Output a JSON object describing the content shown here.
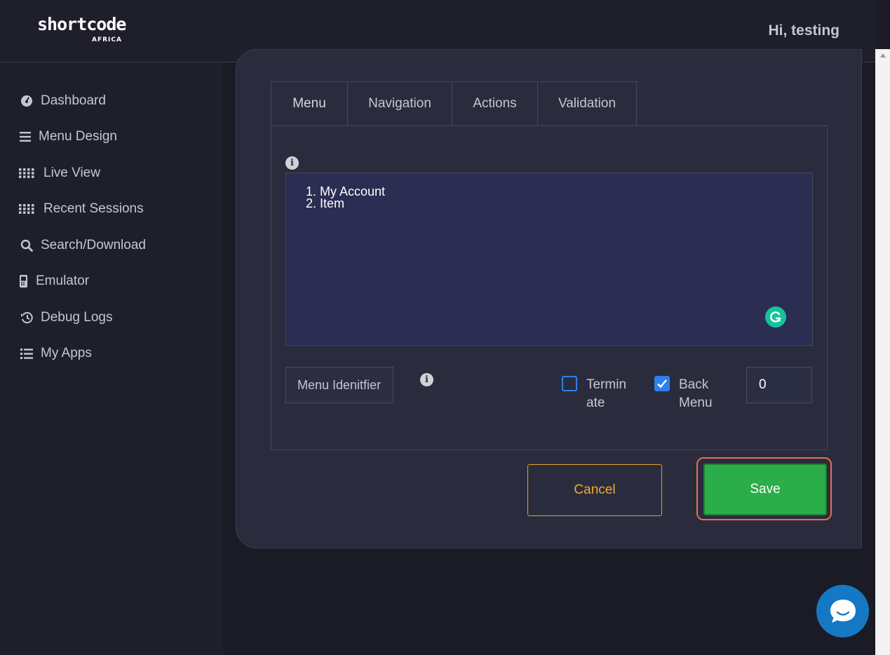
{
  "header": {
    "logo_text": "shortcode",
    "logo_subtext": "AFRICA",
    "greeting": "Hi, testing"
  },
  "sidebar": {
    "items": [
      {
        "label": "Dashboard",
        "icon": "gauge-icon"
      },
      {
        "label": "Menu Design",
        "icon": "bars-icon"
      },
      {
        "label": "Live View",
        "icon": "grid-dots-icon"
      },
      {
        "label": "Recent Sessions",
        "icon": "grid-dots-icon"
      },
      {
        "label": "Search/Download",
        "icon": "search-icon"
      },
      {
        "label": "Emulator",
        "icon": "phone-icon"
      },
      {
        "label": "Debug Logs",
        "icon": "history-icon"
      },
      {
        "label": "My Apps",
        "icon": "list-icon"
      }
    ]
  },
  "tabs": [
    {
      "label": "Menu",
      "active": true
    },
    {
      "label": "Navigation",
      "active": false
    },
    {
      "label": "Actions",
      "active": false
    },
    {
      "label": "Validation",
      "active": false
    }
  ],
  "menu_panel": {
    "menu_text": "1. My Account\n2. Item",
    "identifier_placeholder": "Menu Idenitfier",
    "terminate": {
      "label_line1": "Termin",
      "label_line2": "ate",
      "checked": false
    },
    "back_menu": {
      "label_line1": "Back",
      "label_line2": "Menu",
      "checked": true
    },
    "number_value": "0"
  },
  "buttons": {
    "cancel_label": "Cancel",
    "save_label": "Save"
  },
  "colors": {
    "accent_green": "#2bad4a",
    "cancel_orange": "#f0a830",
    "highlight_outline": "#e8704a",
    "checkbox_blue": "#2f80ed",
    "chat_blue": "#1578c4"
  }
}
